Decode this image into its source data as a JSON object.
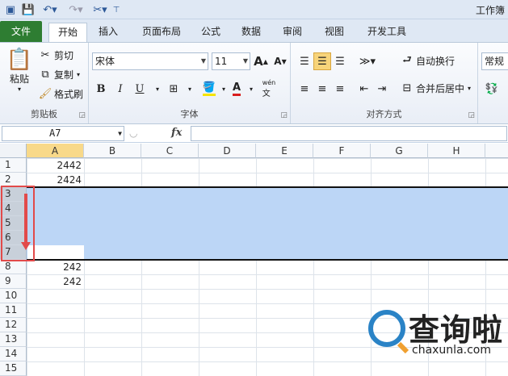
{
  "window": {
    "title": "工作簿"
  },
  "quick_access": {
    "icons": [
      "save-icon",
      "undo-icon",
      "redo-icon",
      "tools-icon",
      "customize-icon"
    ]
  },
  "tabs": [
    "文件",
    "开始",
    "插入",
    "页面布局",
    "公式",
    "数据",
    "审阅",
    "视图",
    "开发工具"
  ],
  "active_tab": "开始",
  "ribbon": {
    "clipboard": {
      "paste": "粘贴",
      "cut": "剪切",
      "copy": "复制",
      "format_painter": "格式刷",
      "label": "剪贴板"
    },
    "font": {
      "name": "宋体",
      "size": "11",
      "bold": "B",
      "italic": "I",
      "underline": "U",
      "grow": "A",
      "shrink": "A",
      "phonetic": "wén",
      "label": "字体"
    },
    "alignment": {
      "wrap_text": "自动换行",
      "merge_center": "合并后居中",
      "label": "对齐方式"
    },
    "number": {
      "format": "常规"
    }
  },
  "formula_bar": {
    "name_box": "A7",
    "fx": "fx",
    "content": ""
  },
  "grid": {
    "columns": [
      "A",
      "B",
      "C",
      "D",
      "E",
      "F",
      "G",
      "H"
    ],
    "rows": [
      "1",
      "2",
      "3",
      "4",
      "5",
      "6",
      "7",
      "8",
      "9",
      "10",
      "11",
      "12",
      "13",
      "14",
      "15"
    ],
    "cells": {
      "A1": "2442",
      "A2": "2424",
      "A8": "242",
      "A9": "242"
    },
    "selected_rows": [
      "3",
      "4",
      "5",
      "6",
      "7"
    ],
    "selection_color": "#bcd6f6",
    "highlight_color": "#e24a4a"
  },
  "watermark": {
    "brand": "查询啦",
    "url": "chaxunla.com"
  }
}
